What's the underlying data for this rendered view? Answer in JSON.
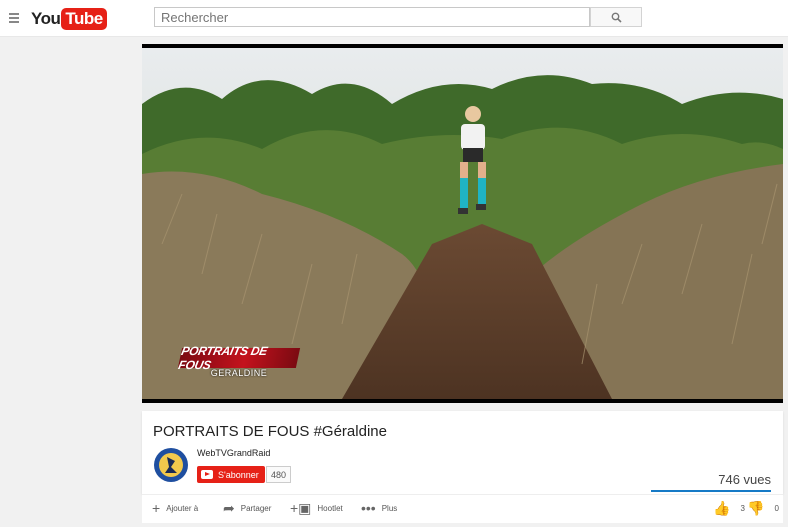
{
  "masthead": {
    "logo_you": "You",
    "logo_tube": "Tube",
    "search": {
      "placeholder": "Rechercher"
    }
  },
  "video": {
    "overlay_title": "PORTRAITS DE FOUS",
    "overlay_subtitle": "GERALDINE",
    "title": "PORTRAITS DE FOUS #Géraldine"
  },
  "channel": {
    "name": "WebTVGrandRaid",
    "subscribe_label": "S'abonner",
    "subscriber_count": "480"
  },
  "stats": {
    "views": "746 vues",
    "likes": "3",
    "dislikes": "0"
  },
  "actions": {
    "add_to": "Ajouter à",
    "share": "Partager",
    "hootlet": "Hootlet",
    "more": "Plus"
  },
  "colors": {
    "brand_red": "#e62117",
    "sentiment_blue": "#167ac6"
  },
  "icons": [
    "menu-icon",
    "search-icon",
    "plus-icon",
    "share-icon",
    "hootlet-icon",
    "more-icon",
    "thumbs-up-icon",
    "thumbs-down-icon"
  ]
}
